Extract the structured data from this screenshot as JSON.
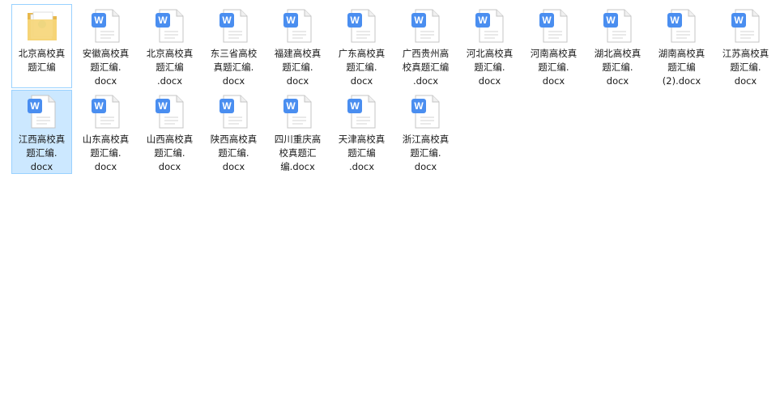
{
  "items": [
    {
      "name": "北京高校真\n题汇编",
      "type": "folder",
      "state": "focused"
    },
    {
      "name": "安徽高校真\n题汇编.\ndocx",
      "type": "docx",
      "state": ""
    },
    {
      "name": "北京高校真\n题汇编\n.docx",
      "type": "docx",
      "state": ""
    },
    {
      "name": "东三省高校\n真题汇编.\ndocx",
      "type": "docx",
      "state": ""
    },
    {
      "name": "福建高校真\n题汇编.\ndocx",
      "type": "docx",
      "state": ""
    },
    {
      "name": "广东高校真\n题汇编.\ndocx",
      "type": "docx",
      "state": ""
    },
    {
      "name": "广西贵州高\n校真题汇编\n.docx",
      "type": "docx",
      "state": ""
    },
    {
      "name": "河北高校真\n题汇编.\ndocx",
      "type": "docx",
      "state": ""
    },
    {
      "name": "河南高校真\n题汇编.\ndocx",
      "type": "docx",
      "state": ""
    },
    {
      "name": "湖北高校真\n题汇编.\ndocx",
      "type": "docx",
      "state": ""
    },
    {
      "name": "湖南高校真\n题汇编\n(2).docx",
      "type": "docx",
      "state": ""
    },
    {
      "name": "江苏高校真\n题汇编.\ndocx",
      "type": "docx",
      "state": ""
    },
    {
      "name": "江西高校真\n题汇编.\ndocx",
      "type": "docx",
      "state": "selected"
    },
    {
      "name": "山东高校真\n题汇编.\ndocx",
      "type": "docx",
      "state": ""
    },
    {
      "name": "山西高校真\n题汇编.\ndocx",
      "type": "docx",
      "state": ""
    },
    {
      "name": "陕西高校真\n题汇编.\ndocx",
      "type": "docx",
      "state": ""
    },
    {
      "name": "四川重庆高\n校真题汇\n编.docx",
      "type": "docx",
      "state": ""
    },
    {
      "name": "天津高校真\n题汇编\n.docx",
      "type": "docx",
      "state": ""
    },
    {
      "name": "浙江高校真\n题汇编.\ndocx",
      "type": "docx",
      "state": ""
    }
  ],
  "icons": {
    "docx": "word-document-icon",
    "folder": "folder-icon"
  },
  "colors": {
    "word_badge": "#4a8ef0",
    "selection_fill": "#cce8ff",
    "selection_border": "#99d1ff",
    "folder_yellow": "#f6d67a"
  }
}
